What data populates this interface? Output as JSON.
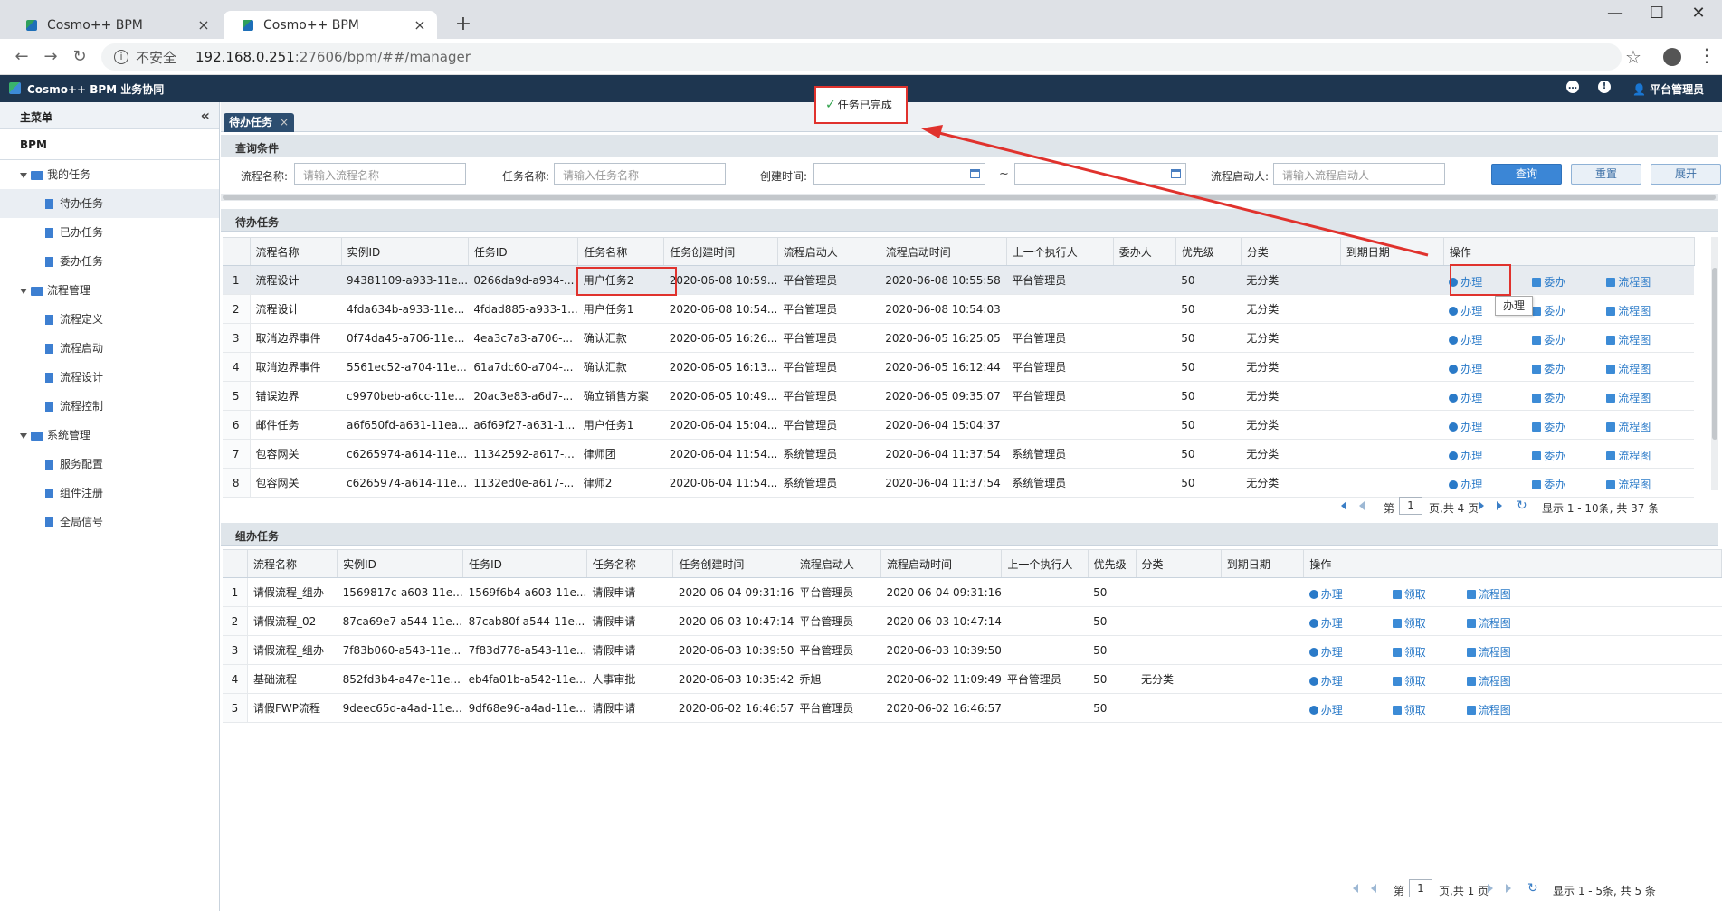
{
  "browser": {
    "tabs": [
      {
        "label": "Cosmo++ BPM"
      },
      {
        "label": "Cosmo++ BPM"
      }
    ],
    "url_insecure": "不安全",
    "url_host": "192.168.0.251",
    "url_rest": ":27606/bpm/##/manager"
  },
  "app": {
    "title": "Cosmo++ BPM 业务协同",
    "user": "平台管理员"
  },
  "sidebar": {
    "header": "主菜单",
    "root": "BPM",
    "groups": [
      {
        "label": "我的任务",
        "items": [
          "待办任务",
          "已办任务",
          "委办任务"
        ]
      },
      {
        "label": "流程管理",
        "items": [
          "流程定义",
          "流程启动",
          "流程设计",
          "流程控制"
        ]
      },
      {
        "label": "系统管理",
        "items": [
          "服务配置",
          "组件注册",
          "全局信号"
        ]
      }
    ]
  },
  "content_tab": "待办任务",
  "toast": "任务已完成",
  "tooltip": "办理",
  "query": {
    "title": "查询条件",
    "process_name_label": "流程名称:",
    "process_name_placeholder": "请输入流程名称",
    "task_name_label": "任务名称:",
    "task_name_placeholder": "请输入任务名称",
    "create_time_label": "创建时间:",
    "tilde": "~",
    "starter_label": "流程启动人:",
    "starter_placeholder": "请输入流程启动人",
    "btn_query": "查询",
    "btn_reset": "重置",
    "btn_expand": "展开"
  },
  "todo": {
    "title": "待办任务",
    "columns": [
      "",
      "流程名称",
      "实例ID",
      "任务ID",
      "任务名称",
      "任务创建时间",
      "流程启动人",
      "流程启动时间",
      "上一个执行人",
      "委办人",
      "优先级",
      "分类",
      "到期日期",
      "操作"
    ],
    "rows": [
      [
        "1",
        "流程设计",
        "94381109-a933-11e...",
        "0266da9d-a934-...",
        "用户任务2",
        "2020-06-08 10:59...",
        "平台管理员",
        "2020-06-08 10:55:58",
        "平台管理员",
        "",
        "50",
        "无分类",
        ""
      ],
      [
        "2",
        "流程设计",
        "4fda634b-a933-11e...",
        "4fdad885-a933-1...",
        "用户任务1",
        "2020-06-08 10:54...",
        "平台管理员",
        "2020-06-08 10:54:03",
        "",
        "",
        "50",
        "无分类",
        ""
      ],
      [
        "3",
        "取消边界事件",
        "0f74da45-a706-11e...",
        "4ea3c7a3-a706-...",
        "确认汇款",
        "2020-06-05 16:26...",
        "平台管理员",
        "2020-06-05 16:25:05",
        "平台管理员",
        "",
        "50",
        "无分类",
        ""
      ],
      [
        "4",
        "取消边界事件",
        "5561ec52-a704-11e...",
        "61a7dc60-a704-...",
        "确认汇款",
        "2020-06-05 16:13...",
        "平台管理员",
        "2020-06-05 16:12:44",
        "平台管理员",
        "",
        "50",
        "无分类",
        ""
      ],
      [
        "5",
        "错误边界",
        "c9970beb-a6cc-11e...",
        "20ac3e83-a6d7-...",
        "确立销售方案",
        "2020-06-05 10:49...",
        "平台管理员",
        "2020-06-05 09:35:07",
        "平台管理员",
        "",
        "50",
        "无分类",
        ""
      ],
      [
        "6",
        "邮件任务",
        "a6f650fd-a631-11ea...",
        "a6f69f27-a631-1...",
        "用户任务1",
        "2020-06-04 15:04...",
        "平台管理员",
        "2020-06-04 15:04:37",
        "",
        "",
        "50",
        "无分类",
        ""
      ],
      [
        "7",
        "包容网关",
        "c6265974-a614-11e...",
        "11342592-a617-...",
        "律师团",
        "2020-06-04 11:54...",
        "系统管理员",
        "2020-06-04 11:37:54",
        "系统管理员",
        "",
        "50",
        "无分类",
        ""
      ],
      [
        "8",
        "包容网关",
        "c6265974-a614-11e...",
        "1132ed0e-a617-...",
        "律师2",
        "2020-06-04 11:54...",
        "系统管理员",
        "2020-06-04 11:37:54",
        "系统管理员",
        "",
        "50",
        "无分类",
        ""
      ]
    ],
    "actions": [
      "办理",
      "委办",
      "流程图"
    ],
    "pager": {
      "page_prefix": "第",
      "page": "1",
      "page_suffix": "页,共 4 页",
      "summary": "显示 1 - 10条, 共 37 条"
    }
  },
  "group": {
    "title": "组办任务",
    "columns": [
      "",
      "流程名称",
      "实例ID",
      "任务ID",
      "任务名称",
      "任务创建时间",
      "流程启动人",
      "流程启动时间",
      "上一个执行人",
      "优先级",
      "分类",
      "到期日期",
      "操作"
    ],
    "rows": [
      [
        "1",
        "请假流程_组办",
        "1569817c-a603-11e...",
        "1569f6b4-a603-11e...",
        "请假申请",
        "2020-06-04 09:31:16",
        "平台管理员",
        "2020-06-04 09:31:16",
        "",
        "50",
        "",
        ""
      ],
      [
        "2",
        "请假流程_02",
        "87ca69e7-a544-11e...",
        "87cab80f-a544-11e...",
        "请假申请",
        "2020-06-03 10:47:14",
        "平台管理员",
        "2020-06-03 10:47:14",
        "",
        "50",
        "",
        ""
      ],
      [
        "3",
        "请假流程_组办",
        "7f83b060-a543-11e...",
        "7f83d778-a543-11e...",
        "请假申请",
        "2020-06-03 10:39:50",
        "平台管理员",
        "2020-06-03 10:39:50",
        "",
        "50",
        "",
        ""
      ],
      [
        "4",
        "基础流程",
        "852fd3b4-a47e-11e...",
        "eb4fa01b-a542-11e...",
        "人事审批",
        "2020-06-03 10:35:42",
        "乔旭",
        "2020-06-02 11:09:49",
        "平台管理员",
        "50",
        "无分类",
        ""
      ],
      [
        "5",
        "请假FWP流程",
        "9deec65d-a4ad-11e...",
        "9df68e96-a4ad-11e...",
        "请假申请",
        "2020-06-02 16:46:57",
        "平台管理员",
        "2020-06-02 16:46:57",
        "",
        "50",
        "",
        ""
      ]
    ],
    "actions": [
      "办理",
      "领取",
      "流程图"
    ],
    "pager": {
      "page_prefix": "第",
      "page": "1",
      "page_suffix": "页,共 1 页",
      "summary": "显示 1 - 5条, 共 5 条"
    }
  }
}
